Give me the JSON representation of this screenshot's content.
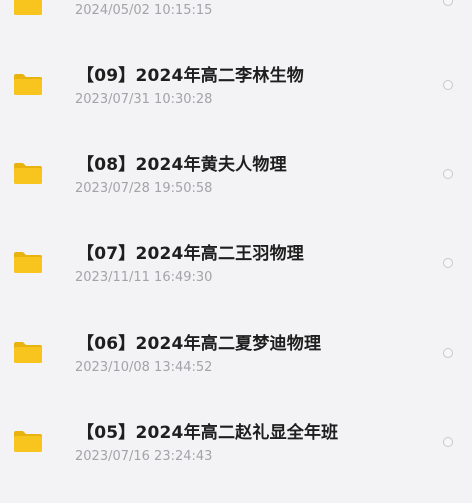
{
  "files": [
    {
      "title": "",
      "date": "2024/05/02 10:15:15",
      "icon": "folder-icon"
    },
    {
      "title": "【09】2024年高二李林生物",
      "date": "2023/07/31 10:30:28",
      "icon": "folder-icon"
    },
    {
      "title": "【08】2024年黄夫人物理",
      "date": "2023/07/28 19:50:58",
      "icon": "folder-icon"
    },
    {
      "title": "【07】2024年高二王羽物理",
      "date": "2023/11/11 16:49:30",
      "icon": "folder-icon"
    },
    {
      "title": "【06】2024年高二夏梦迪物理",
      "date": "2023/10/08 13:44:52",
      "icon": "folder-icon"
    },
    {
      "title": "【05】2024年高二赵礼显全年班",
      "date": "2023/07/16 23:24:43",
      "icon": "folder-icon"
    }
  ],
  "colors": {
    "folder": "#f7c51e",
    "folder_tab": "#e9b30f",
    "background": "#f3f3f5"
  }
}
